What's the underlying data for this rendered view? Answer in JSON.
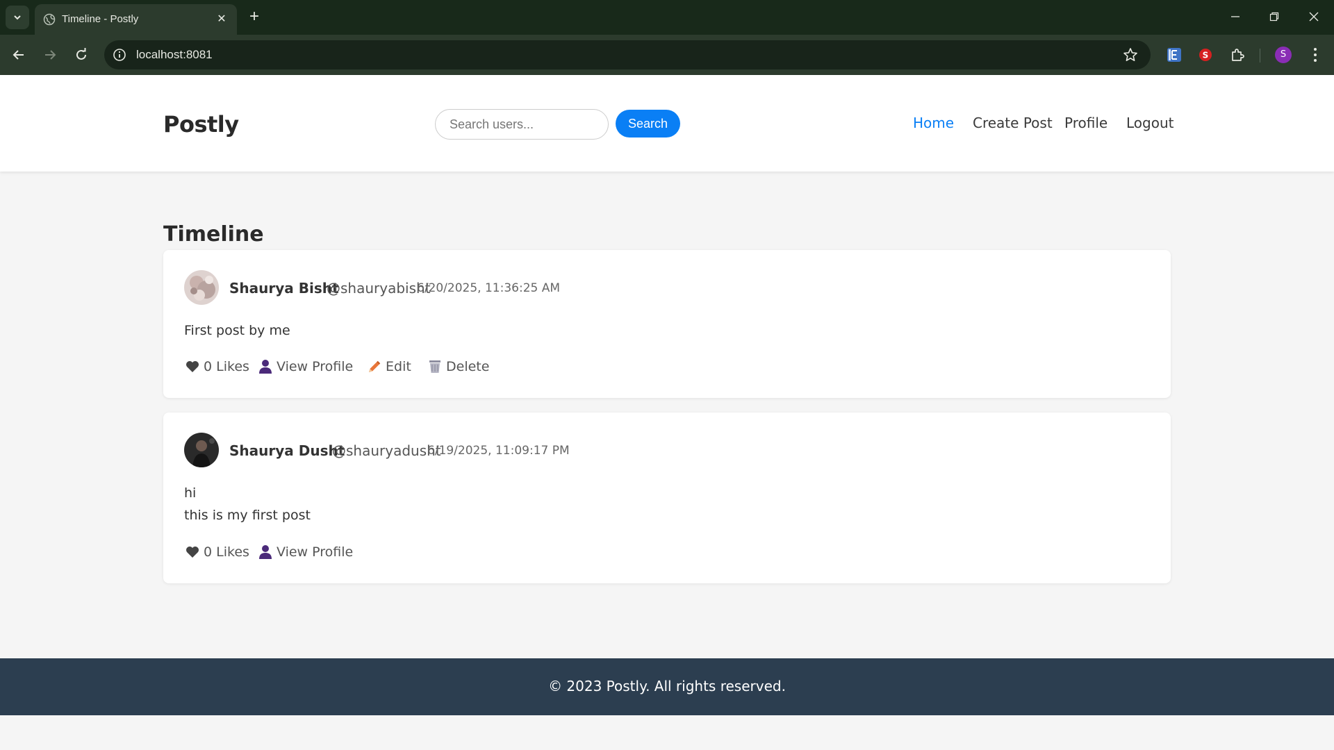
{
  "browser": {
    "tab_title": "Timeline - Postly",
    "url": "localhost:8081",
    "profile_initial": "S",
    "colors": {
      "frame": "#18291a",
      "toolbar": "#2c3b2d",
      "omnibox": "#18241a"
    }
  },
  "header": {
    "brand": "Postly",
    "search_placeholder": "Search users...",
    "search_button": "Search",
    "nav": [
      {
        "label": "Home",
        "active": true
      },
      {
        "label": "Create Post",
        "active": false
      },
      {
        "label": "Profile",
        "active": false
      },
      {
        "label": "Logout",
        "active": false
      }
    ]
  },
  "main": {
    "title": "Timeline",
    "posts": [
      {
        "name": "Shaurya Bisht",
        "handle": "@shauryabisht",
        "timestamp": "6/20/2025, 11:36:25 AM",
        "body_lines": [
          "First post by me"
        ],
        "likes": "0 Likes",
        "view_profile": "View Profile",
        "edit": "Edit",
        "delete": "Delete"
      },
      {
        "name": "Shaurya Dusht",
        "handle": "@shauryadusht",
        "timestamp": "6/19/2025, 11:09:17 PM",
        "body_lines": [
          "hi",
          "this is my first post"
        ],
        "likes": "0 Likes",
        "view_profile": "View Profile"
      }
    ]
  },
  "footer": {
    "text": "© 2023 Postly. All rights reserved."
  },
  "colors": {
    "accent": "#0a7ff5",
    "footer_bg": "#2c3e50",
    "page_bg": "#f5f5f5"
  },
  "icons": {
    "like": "heart-icon",
    "profile": "person-icon",
    "edit": "pencil-icon",
    "delete": "wastebasket-icon"
  }
}
